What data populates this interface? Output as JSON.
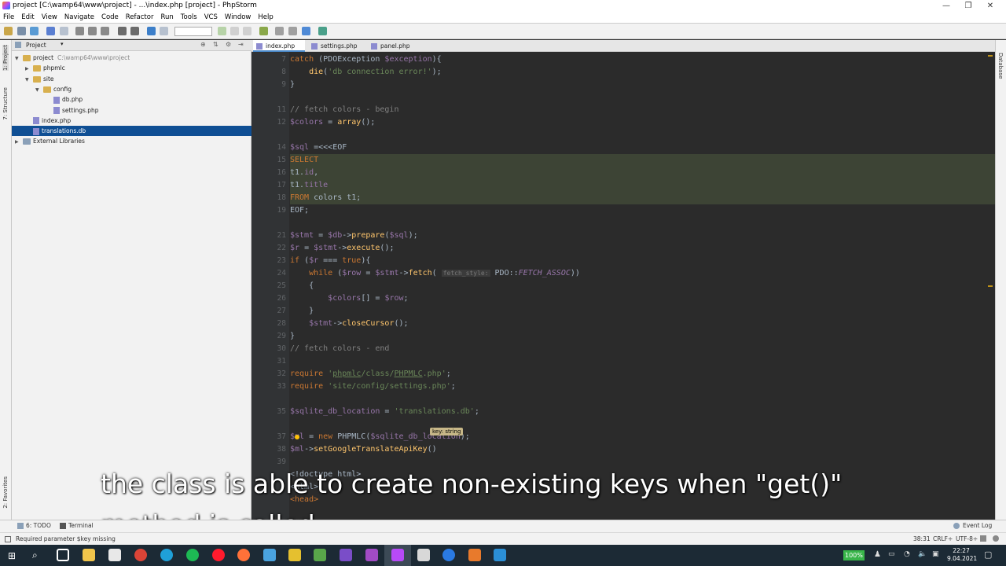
{
  "window": {
    "title": "project [C:\\wamp64\\www\\project] - ...\\index.php [project] - PhpStorm",
    "controls": [
      "—",
      "❐",
      "✕"
    ]
  },
  "menu": [
    "File",
    "Edit",
    "View",
    "Navigate",
    "Code",
    "Refactor",
    "Run",
    "Tools",
    "VCS",
    "Window",
    "Help"
  ],
  "left_strip": {
    "project_tab": "1: Project",
    "structure_tab": "7: Structure",
    "favorites_tab": "2: Favorites"
  },
  "project_panel": {
    "header": "Project",
    "tree": [
      {
        "label": "project",
        "path": "C:\\wamp64\\www\\project",
        "type": "folder",
        "depth": 0,
        "expanded": true
      },
      {
        "label": "phpmlc",
        "type": "folder",
        "depth": 1,
        "expanded": false
      },
      {
        "label": "site",
        "type": "folder",
        "depth": 1,
        "expanded": true
      },
      {
        "label": "config",
        "type": "folder",
        "depth": 2,
        "expanded": true
      },
      {
        "label": "db.php",
        "type": "file",
        "depth": 3
      },
      {
        "label": "settings.php",
        "type": "file",
        "depth": 3
      },
      {
        "label": "index.php",
        "type": "file",
        "depth": 1
      },
      {
        "label": "translations.db",
        "type": "file",
        "depth": 1,
        "selected": true
      },
      {
        "label": "External Libraries",
        "type": "lib",
        "depth": 0
      }
    ]
  },
  "tabs": [
    {
      "label": "index.php",
      "active": true
    },
    {
      "label": "settings.php",
      "active": false
    },
    {
      "label": "panel.php",
      "active": false
    }
  ],
  "right_strip": {
    "database_tab": "Database"
  },
  "editor": {
    "line_numbers": [
      "7",
      "8",
      "9",
      "",
      "11",
      "12",
      "",
      "14",
      "15",
      "16",
      "17",
      "18",
      "19",
      "",
      "21",
      "22",
      "23",
      "24",
      "25",
      "26",
      "27",
      "28",
      "29",
      "30",
      "31",
      "32",
      "33",
      "",
      "35",
      "",
      "37",
      "38",
      "39"
    ],
    "param_hint": "fetch_style:",
    "tooltip": "key: string"
  },
  "bottom_tools": {
    "todo": "6: TODO",
    "terminal": "Terminal",
    "event_log": "Event Log"
  },
  "status": {
    "message": "Required parameter $key missing",
    "position": "38:31",
    "line_sep": "CRLF÷",
    "encoding": "UTF-8÷"
  },
  "taskbar": {
    "battery": "100%",
    "time": "22:27",
    "date": "9.04.2021"
  },
  "subtitle": {
    "line1": "the class is able to create non-existing keys when \"get()\"",
    "line2": "method is called."
  },
  "colors": {
    "keyword": "#cc7832",
    "variable": "#9876aa",
    "function": "#ffc66d",
    "string": "#6a8759",
    "comment": "#808080",
    "selection": "#0f4f94"
  }
}
